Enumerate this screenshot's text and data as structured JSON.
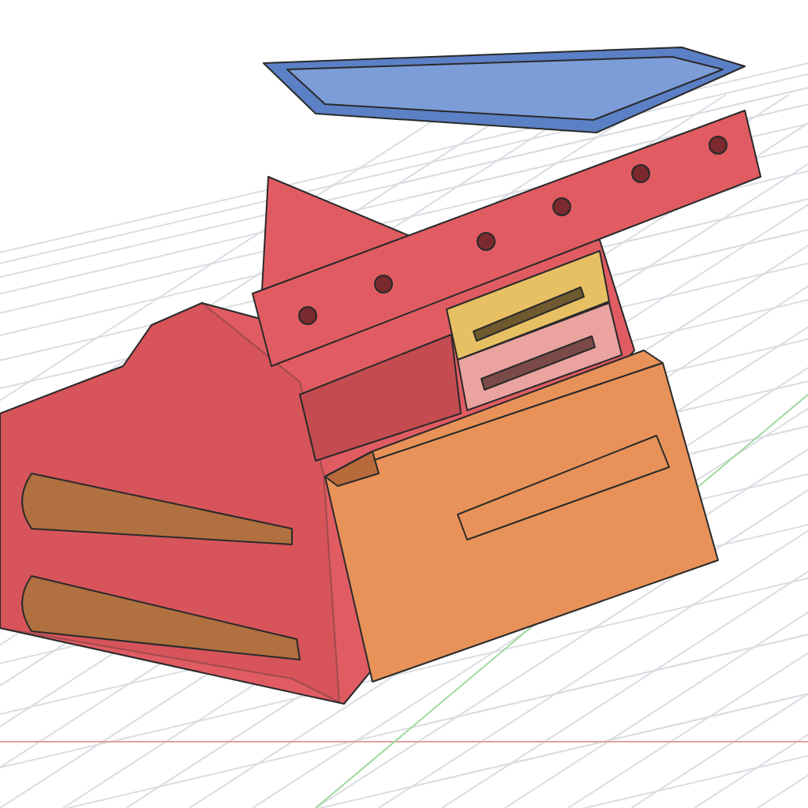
{
  "model": {
    "parts": [
      {
        "kind": "body",
        "color": "#e05c62"
      },
      {
        "kind": "rail",
        "color": "#e05c62"
      },
      {
        "kind": "tray",
        "color": "#e8c064"
      },
      {
        "kind": "bin",
        "color": "#eaa39f"
      },
      {
        "kind": "drawer",
        "color": "#e8925a"
      },
      {
        "kind": "lid",
        "color": "#5b80c6"
      }
    ]
  }
}
